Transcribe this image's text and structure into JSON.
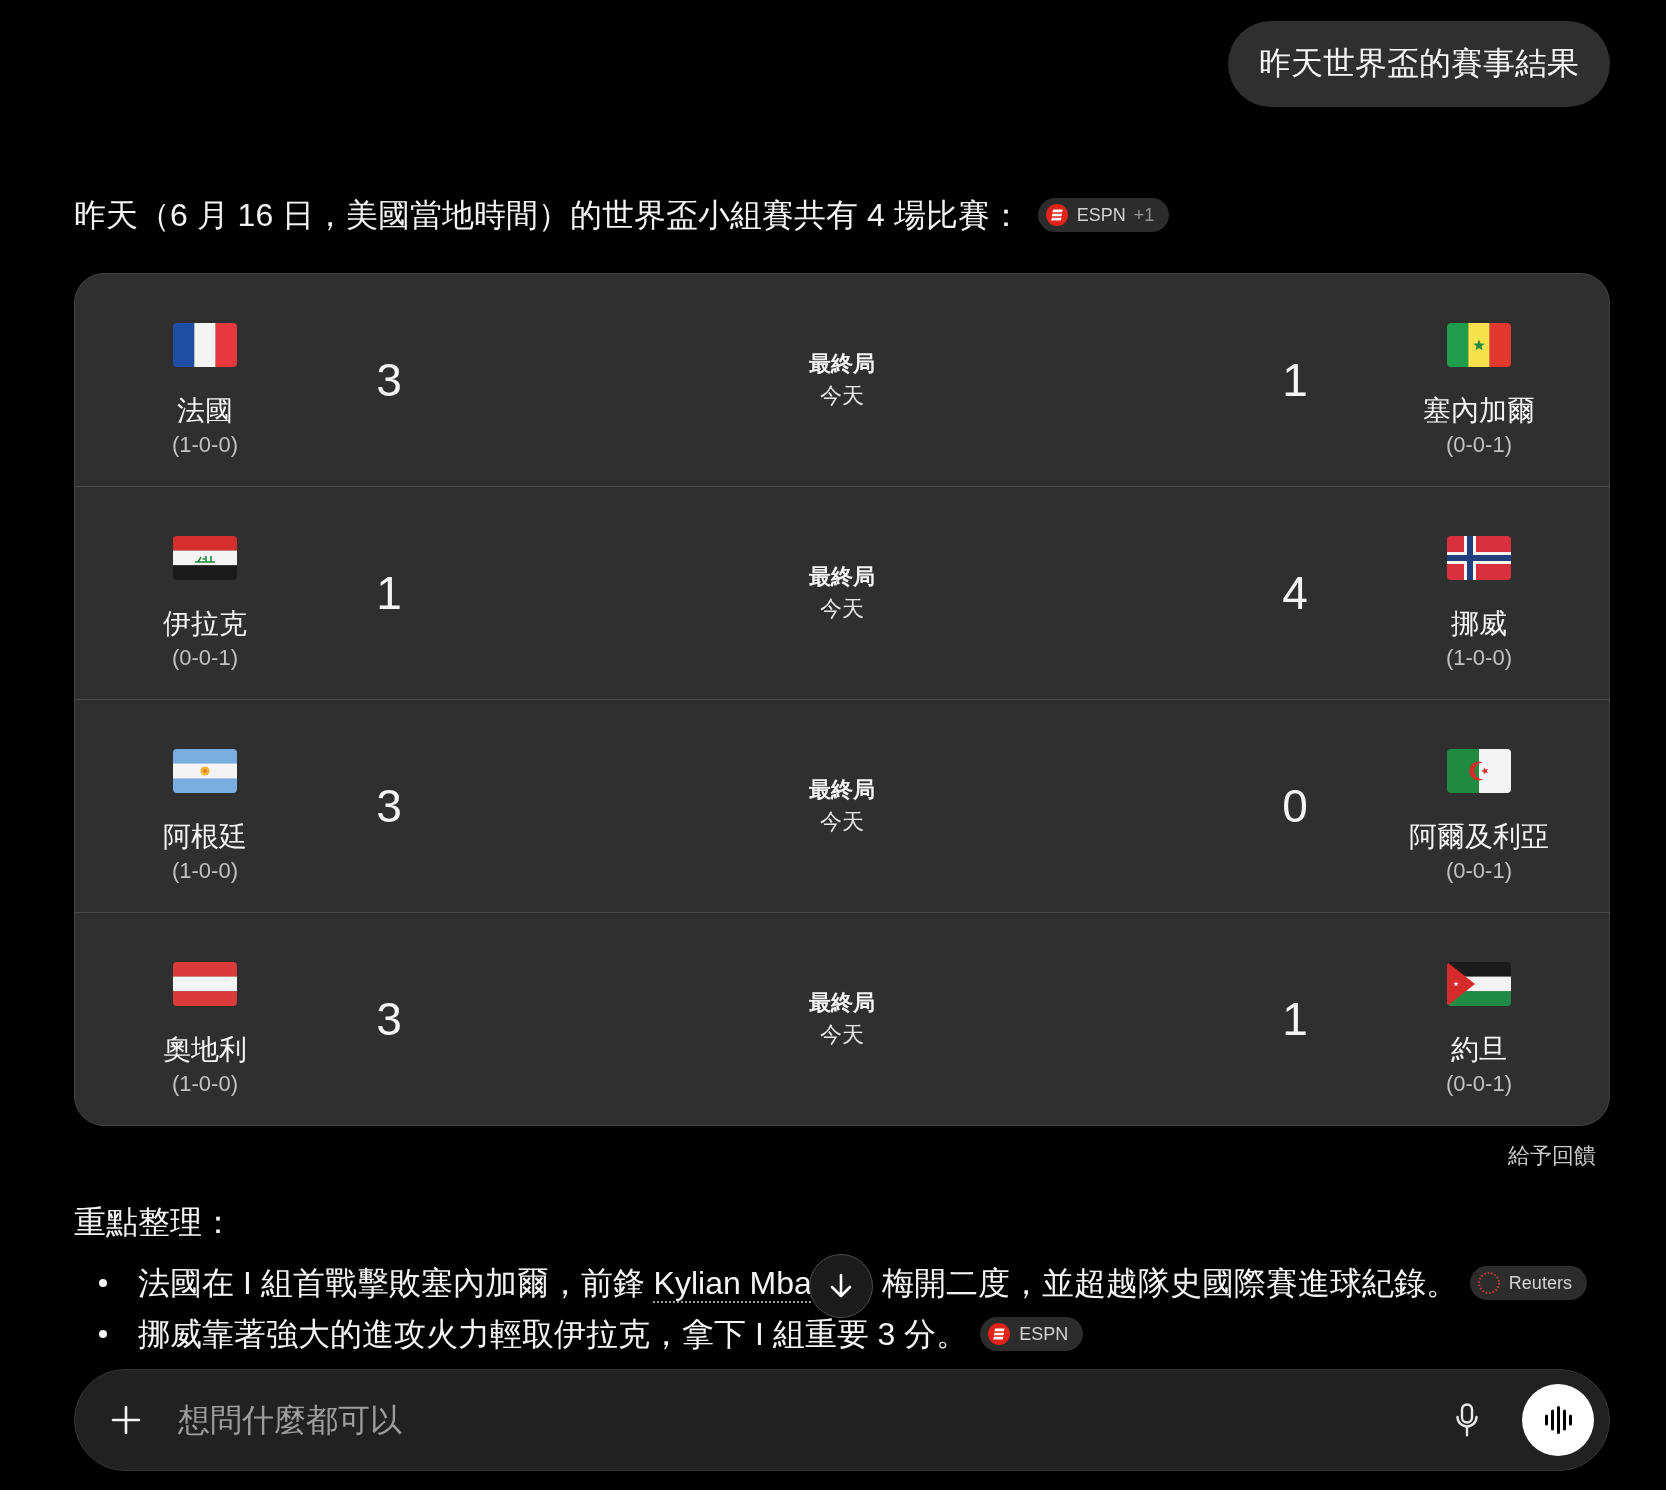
{
  "user_message": {
    "text": "昨天世界盃的賽事結果"
  },
  "response": {
    "intro": {
      "text": "昨天（6 月 16 日，美國當地時間）的世界盃小組賽共有 4 場比賽：",
      "source": {
        "kind": "espn",
        "label": "ESPN",
        "extra": "+1"
      }
    },
    "matches": [
      {
        "home": {
          "kind": "france",
          "name": "法國",
          "record": "(1-0-0)"
        },
        "home_score": "3",
        "status": "最終局",
        "date": "今天",
        "away_score": "1",
        "away": {
          "kind": "senegal",
          "name": "塞內加爾",
          "record": "(0-0-1)"
        }
      },
      {
        "home": {
          "kind": "iraq",
          "name": "伊拉克",
          "record": "(0-0-1)"
        },
        "home_score": "1",
        "status": "最終局",
        "date": "今天",
        "away_score": "4",
        "away": {
          "kind": "norway",
          "name": "挪威",
          "record": "(1-0-0)"
        }
      },
      {
        "home": {
          "kind": "argentina",
          "name": "阿根廷",
          "record": "(1-0-0)"
        },
        "home_score": "3",
        "status": "最終局",
        "date": "今天",
        "away_score": "0",
        "away": {
          "kind": "algeria",
          "name": "阿爾及利亞",
          "record": "(0-0-1)"
        }
      },
      {
        "home": {
          "kind": "austria",
          "name": "奧地利",
          "record": "(1-0-0)"
        },
        "home_score": "3",
        "status": "最終局",
        "date": "今天",
        "away_score": "1",
        "away": {
          "kind": "jordan",
          "name": "約旦",
          "record": "(0-0-1)"
        }
      }
    ],
    "feedback": "給予回饋",
    "summary": {
      "heading": "重點整理：",
      "bullets": [
        {
          "segments": [
            {
              "kind": "text",
              "text": "法國在 I 組首戰擊敗塞內加爾，前鋒 "
            },
            {
              "kind": "link",
              "text": "Kylian Mba"
            },
            {
              "kind": "scroll_button"
            },
            {
              "kind": "text",
              "text": "梅開二度，並超越隊史國際賽進球紀錄。"
            }
          ],
          "source": {
            "kind": "reuters",
            "label": "Reuters"
          }
        },
        {
          "segments": [
            {
              "kind": "text",
              "text": "挪威靠著強大的進攻火力輕取伊拉克，拿下 I 組重要 3 分。"
            }
          ],
          "source": {
            "kind": "espn",
            "label": "ESPN"
          }
        }
      ]
    }
  },
  "composer": {
    "placeholder": "想問什麼都可以"
  }
}
